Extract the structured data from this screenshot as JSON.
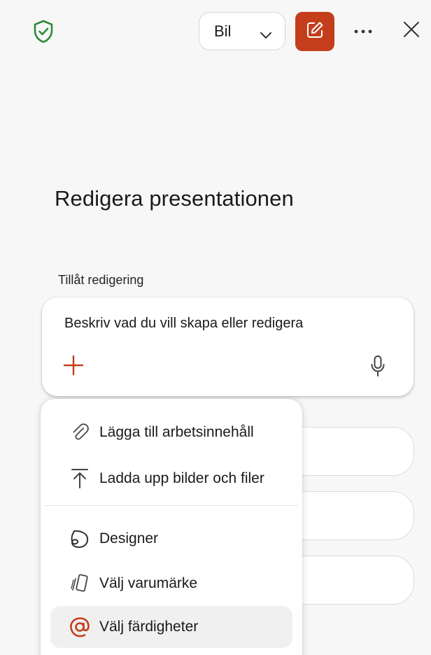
{
  "header": {
    "mode_dropdown": {
      "value": "Bil"
    }
  },
  "main": {
    "title": "Redigera presentationen",
    "allow_label": "Tillåt redigering",
    "prompt": {
      "placeholder": "Beskriv vad du vill skapa eller redigera"
    }
  },
  "menu": {
    "items": [
      {
        "label": "Lägga till arbetsinnehåll",
        "icon": "paperclip-icon"
      },
      {
        "label": "Ladda upp bilder och filer",
        "icon": "upload-icon"
      },
      {
        "label": "Designer",
        "icon": "designer-icon"
      },
      {
        "label": "Välj varumärke",
        "icon": "brand-icon"
      },
      {
        "label": "Välj färdigheter",
        "icon": "at-sign-icon"
      }
    ]
  },
  "colors": {
    "accent": "#c43e1c",
    "shield": "#2e8b3a",
    "background": "#f7f7f7"
  }
}
